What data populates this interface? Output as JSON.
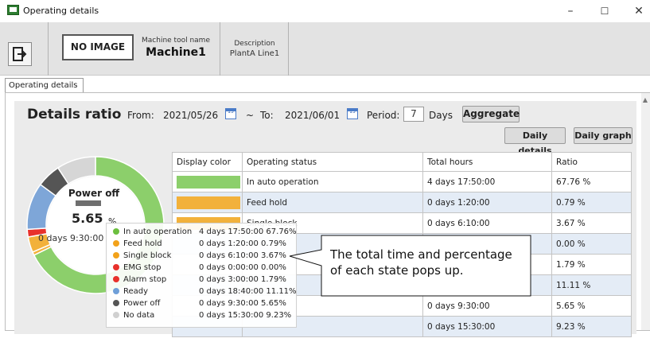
{
  "window": {
    "title": "Operating details"
  },
  "header": {
    "no_image": "NO IMAGE",
    "machine_label": "Machine tool name",
    "machine_value": "Machine1",
    "description_label": "Description",
    "description_value": "PlantA Line1"
  },
  "tab": {
    "label": "Operating details"
  },
  "details": {
    "title": "Details ratio",
    "from_label": "From:",
    "from_value": "2021/05/26",
    "tilde": "~",
    "to_label": "To:",
    "to_value": "2021/06/01",
    "period_label": "Period:",
    "period_value": "7",
    "days_label": "Days",
    "aggregate_label": "Aggregate",
    "daily_details_label": "Daily details",
    "daily_graph_label": "Daily graph"
  },
  "table": {
    "headers": [
      "Display color",
      "Operating status",
      "Total hours",
      "Ratio"
    ],
    "rows": [
      {
        "color": "#8ccf6b",
        "status": "In auto operation",
        "hours": "4 days 17:50:00",
        "ratio": "67.76 %"
      },
      {
        "color": "#f2b13b",
        "status": "Feed hold",
        "hours": "0 days 1:20:00",
        "ratio": "0.79 %"
      },
      {
        "color": "#f2b13b",
        "status": "Single block",
        "hours": "0 days 6:10:00",
        "ratio": "3.67 %"
      },
      {
        "color": "#ffffff",
        "status": "",
        "hours": "",
        "ratio": "0.00 %"
      },
      {
        "color": "#ffffff",
        "status": "",
        "hours": "",
        "ratio": "1.79 %"
      },
      {
        "color": "#ffffff",
        "status": "",
        "hours": "",
        "ratio": "11.11 %"
      },
      {
        "color": "#ffffff",
        "status": "",
        "hours": "0 days 9:30:00",
        "ratio": "5.65 %"
      },
      {
        "color": "#ffffff",
        "status": "",
        "hours": "0 days 15:30:00",
        "ratio": "9.23 %"
      }
    ]
  },
  "donut": {
    "center_title": "Power off",
    "center_pct": "5.65",
    "center_unit": "%",
    "center_time": "0 days 9:30:00",
    "segments": [
      {
        "name": "In auto operation",
        "value": 67.76,
        "color": "#8ccf6b"
      },
      {
        "name": "Feed hold",
        "value": 0.79,
        "color": "#f2b13b"
      },
      {
        "name": "Single block",
        "value": 3.67,
        "color": "#f2b13b"
      },
      {
        "name": "Alarm stop",
        "value": 1.79,
        "color": "#e8312c"
      },
      {
        "name": "Ready",
        "value": 11.11,
        "color": "#7ea6d8"
      },
      {
        "name": "Power off",
        "value": 5.65,
        "color": "#555555"
      },
      {
        "name": "No data",
        "value": 9.23,
        "color": "#d6d6d6"
      }
    ]
  },
  "tooltip": {
    "rows": [
      {
        "dot": "#6cbf3f",
        "name": "In auto operation",
        "value": "4 days 17:50:00 67.76%"
      },
      {
        "dot": "#f2a21b",
        "name": "Feed hold",
        "value": "0 days 1:20:00  0.79%"
      },
      {
        "dot": "#f2a21b",
        "name": "Single block",
        "value": "0 days 6:10:00  3.67%"
      },
      {
        "dot": "#e8312c",
        "name": "EMG stop",
        "value": "0 days 0:00:00  0.00%"
      },
      {
        "dot": "#e8312c",
        "name": "Alarm stop",
        "value": "0 days 3:00:00  1.79%"
      },
      {
        "dot": "#6f9fd8",
        "name": "Ready",
        "value": "0 days 18:40:00 11.11%"
      },
      {
        "dot": "#555555",
        "name": "Power off",
        "value": "0 days 9:30:00  5.65%"
      },
      {
        "dot": "#d0d0d0",
        "name": "No data",
        "value": "0 days 15:30:00 9.23%"
      }
    ]
  },
  "callout": {
    "line1": "The total time and percentage",
    "line2": "of each state pops up."
  }
}
